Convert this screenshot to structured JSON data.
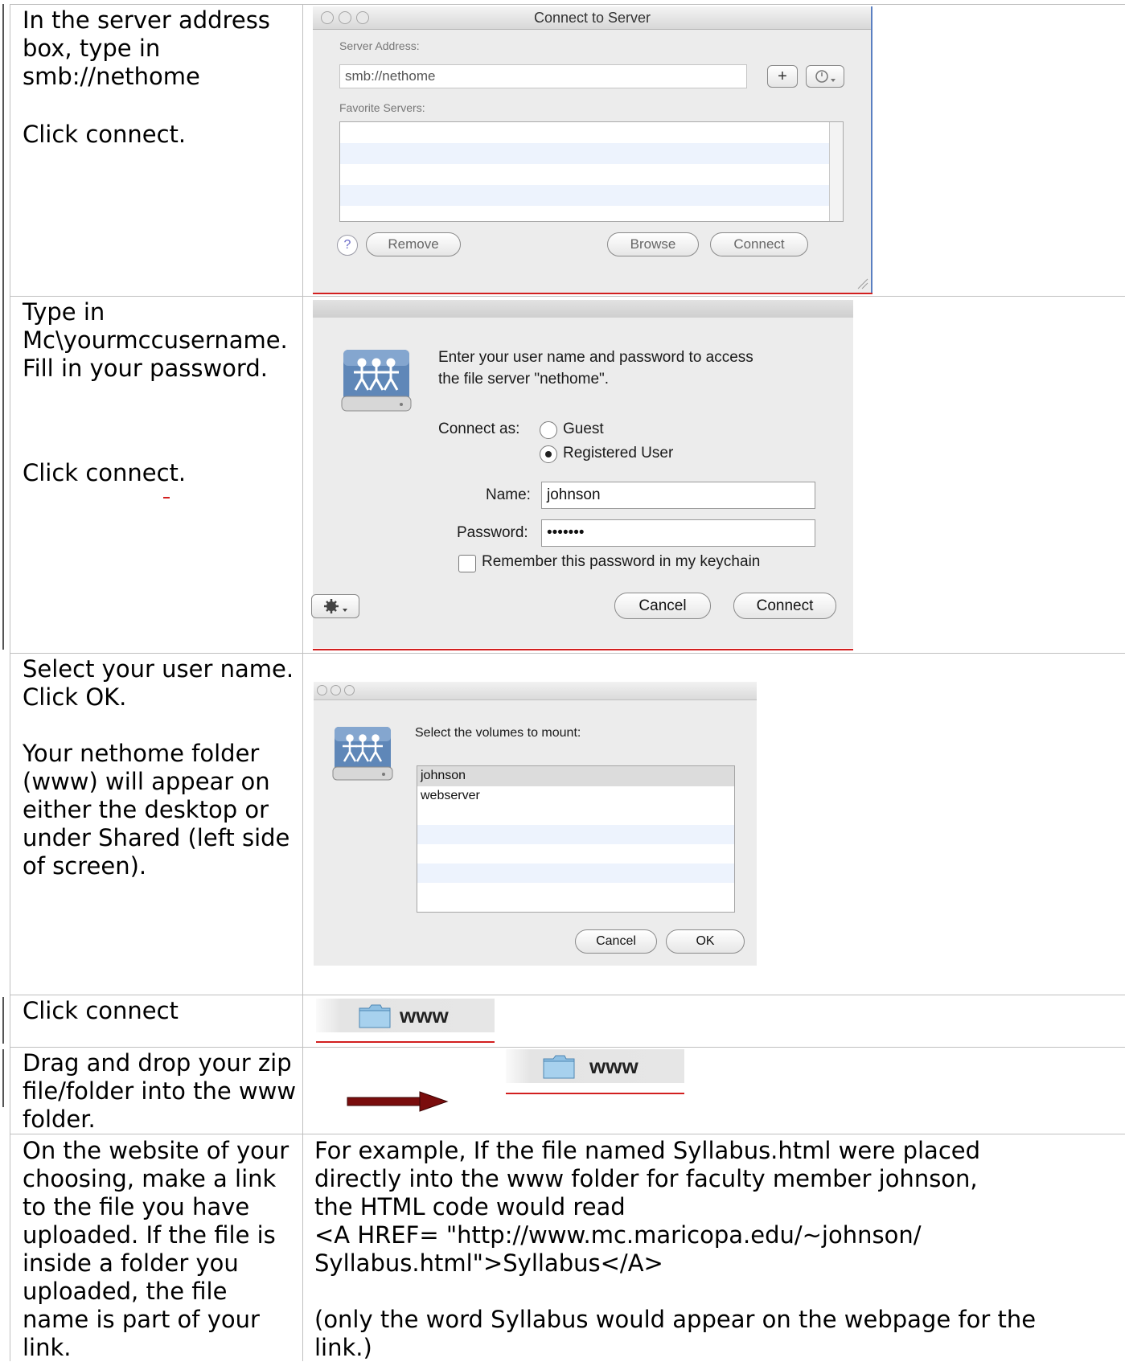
{
  "rows": [
    {
      "instruction": [
        "In the server address box, type in smb://nethome",
        "Click connect."
      ],
      "dialog": {
        "title": "Connect to Server",
        "server_address_label": "Server Address:",
        "server_address_value": "smb://nethome",
        "favorite_servers_label": "Favorite Servers:",
        "add_symbol": "+",
        "help_symbol": "?",
        "remove_label": "Remove",
        "browse_label": "Browse",
        "connect_label": "Connect"
      }
    },
    {
      "instruction": [
        "Type in Mc\\yourmccusername. Fill in your password.",
        "Click connect."
      ],
      "dialog": {
        "message_line1": "Enter your user name and password to access",
        "message_line2": "the file server \"nethome\".",
        "connect_as_label": "Connect as:",
        "guest_label": "Guest",
        "registered_label": "Registered User",
        "name_label": "Name:",
        "name_value": "johnson",
        "password_label": "Password:",
        "password_value": "•••••••",
        "remember_label": "Remember this password in my keychain",
        "cancel_label": "Cancel",
        "connect_label": "Connect"
      }
    },
    {
      "instruction": [
        "Select your user name. Click OK.",
        "Your nethome folder (www) will appear on either the desktop or under Shared (left side of screen)."
      ],
      "dialog": {
        "prompt": "Select the volumes to mount:",
        "volumes": [
          "johnson",
          "webserver"
        ],
        "cancel_label": "Cancel",
        "ok_label": "OK"
      }
    },
    {
      "instruction": [
        "Click connect"
      ],
      "folder_label": "www"
    },
    {
      "instruction": [
        "Drag and drop your zip file/folder into the www folder."
      ],
      "folder_label": "www"
    },
    {
      "instruction": [
        "On the website of your choosing, make a link to the file you have uploaded. If the file is inside a folder you uploaded, the file name is part of your link."
      ],
      "example": {
        "line1": "For example, If the file named Syllabus.html were placed",
        "line2": "directly into the www folder for faculty member johnson,",
        "line3": "the HTML code would read",
        "line4": "<A HREF= \"http://www.mc.maricopa.edu/~johnson/",
        "line5": "Syllabus.html\">Syllabus</A>",
        "line6": "(only the word Syllabus would appear on the webpage for the",
        "line7": "link.)"
      }
    }
  ],
  "colors": {
    "grid": "#bfbfbf",
    "red_underline": "#d21f1f",
    "arrow": "#7a0d0d"
  }
}
